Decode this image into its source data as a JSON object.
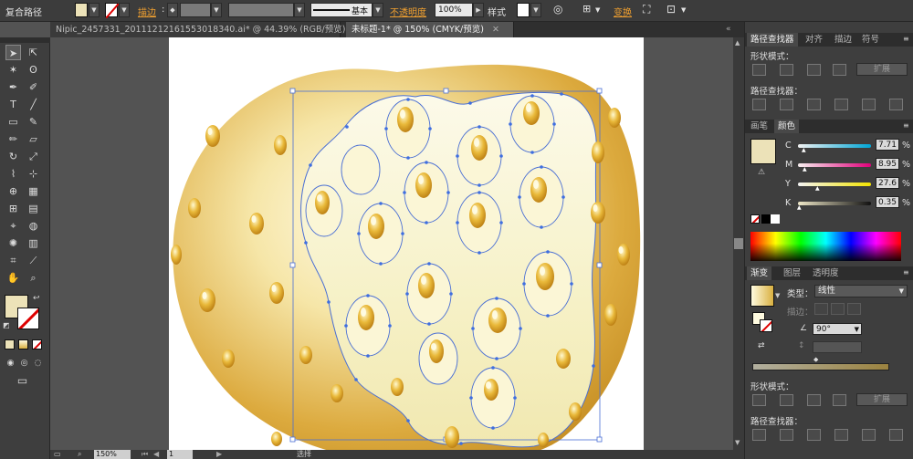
{
  "topbar": {
    "mode_label": "复合路径",
    "stroke_label": "描边",
    "stroke_profile": "基本",
    "opacity_label": "不透明度",
    "opacity_value": "100%",
    "style_label": "样式",
    "transform_label": "变换"
  },
  "tabs": [
    {
      "label": "Nipic_2457331_20111212161553018340.ai* @ 44.39% (RGB/预览)"
    },
    {
      "label": "未标题-1* @ 150% (CMYK/预览)"
    }
  ],
  "panel_pathfinder_top": {
    "tabs": [
      "路径查找器",
      "对齐",
      "描边",
      "符号"
    ],
    "shape_modes_label": "形状模式：",
    "pathfinders_label": "路径查找器：",
    "expand_label": "扩展"
  },
  "panel_color": {
    "tabs": [
      "画笔",
      "颜色"
    ],
    "channels": [
      {
        "name": "C",
        "value": "7.71",
        "unit": "%"
      },
      {
        "name": "M",
        "value": "8.95",
        "unit": "%"
      },
      {
        "name": "Y",
        "value": "27.6",
        "unit": "%"
      },
      {
        "name": "K",
        "value": "0.35",
        "unit": "%"
      }
    ],
    "fill_color": "#ece2b8"
  },
  "panel_gradient": {
    "tabs": [
      "渐变",
      "图层",
      "透明度"
    ],
    "type_label": "类型：",
    "type_value": "线性",
    "stroke_label": "描边：",
    "angle_value": "90°"
  },
  "panel_pathfinder_bottom": {
    "shape_modes_label": "形状模式：",
    "pathfinders_label": "路径查找器：",
    "expand_label": "扩展"
  },
  "status": {
    "zoom": "150%",
    "page": "1",
    "tool": "选择"
  },
  "colors": {
    "accent": "#f0a030",
    "lotus_light": "#f7f2c8",
    "lotus_dark": "#c99528",
    "anchor": "#3e6ee0"
  }
}
